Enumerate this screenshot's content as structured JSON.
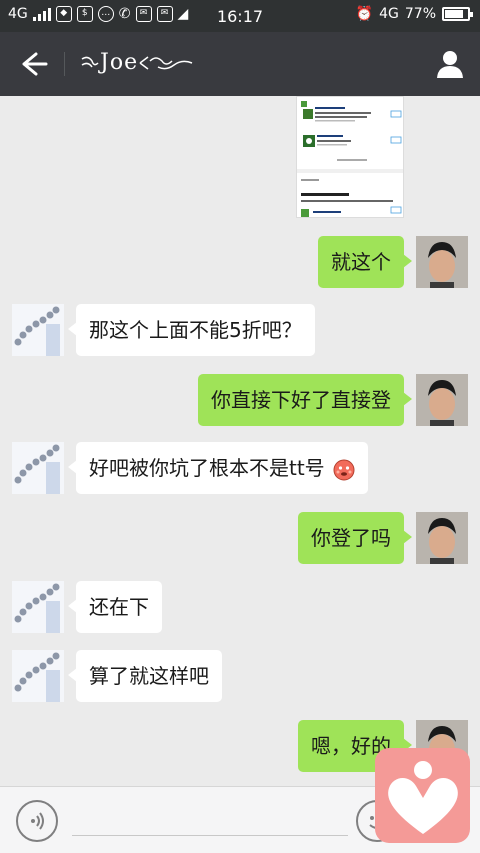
{
  "status_bar": {
    "network_left": "4G",
    "time": "16:17",
    "network_right": "4G",
    "battery": "77%",
    "battery_level": 0.77
  },
  "header": {
    "title": "Joe"
  },
  "messages": [
    {
      "side": "me",
      "text": "就这个"
    },
    {
      "side": "other",
      "text": "那这个上面不能5折吧？"
    },
    {
      "side": "me",
      "text": "你直接下好了直接登"
    },
    {
      "side": "other",
      "text": "好吧被你坑了根本不是tt号"
    },
    {
      "side": "me",
      "text": "你登了吗"
    },
    {
      "side": "other",
      "text": "还在下"
    },
    {
      "side": "other",
      "text": "算了就这样吧"
    },
    {
      "side": "me",
      "text": "嗯，好的"
    }
  ],
  "icons": [
    "back-arrow-icon",
    "profile-icon",
    "voice-icon",
    "emoji-icon",
    "heart-logo-icon",
    "embarrassed-emoji-icon"
  ],
  "colors": {
    "title_bar": "#393a3f",
    "status_bar": "#2f3233",
    "chat_bg": "#ebebeb",
    "my_bubble": "#9fe358",
    "their_bubble": "#ffffff",
    "floating_logo": "#f49a97"
  }
}
